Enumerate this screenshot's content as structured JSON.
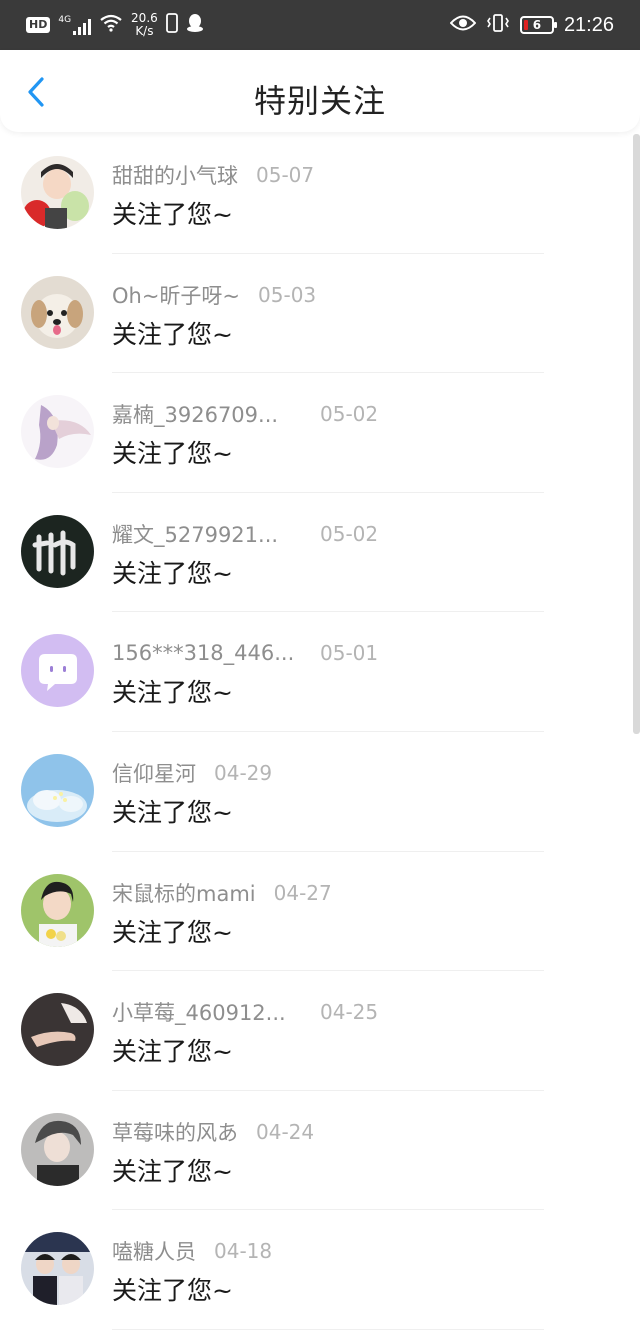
{
  "status_bar": {
    "hd": "HD",
    "net_type": "4G",
    "speed_value": "20.6",
    "speed_unit": "K/s",
    "battery_level": "6",
    "time": "21:26"
  },
  "header": {
    "title": "特别关注",
    "accent_color": "#2196f3"
  },
  "list": [
    {
      "name": "甜甜的小气球",
      "date": "05-07",
      "message": "关注了您~"
    },
    {
      "name": "Oh~昕子呀~",
      "date": "05-03",
      "message": "关注了您~"
    },
    {
      "name": "嘉楠_3926709...",
      "date": "05-02",
      "message": "关注了您~"
    },
    {
      "name": "耀文_5279921...",
      "date": "05-02",
      "message": "关注了您~"
    },
    {
      "name": "156***318_446...",
      "date": "05-01",
      "message": "关注了您~"
    },
    {
      "name": "信仰星河",
      "date": "04-29",
      "message": "关注了您~"
    },
    {
      "name": "宋鼠标的mami",
      "date": "04-27",
      "message": "关注了您~"
    },
    {
      "name": "小草莓_460912...",
      "date": "04-25",
      "message": "关注了您~"
    },
    {
      "name": "草莓味的风あ",
      "date": "04-24",
      "message": "关注了您~"
    },
    {
      "name": "嗑糖人员",
      "date": "04-18",
      "message": "关注了您~"
    }
  ]
}
